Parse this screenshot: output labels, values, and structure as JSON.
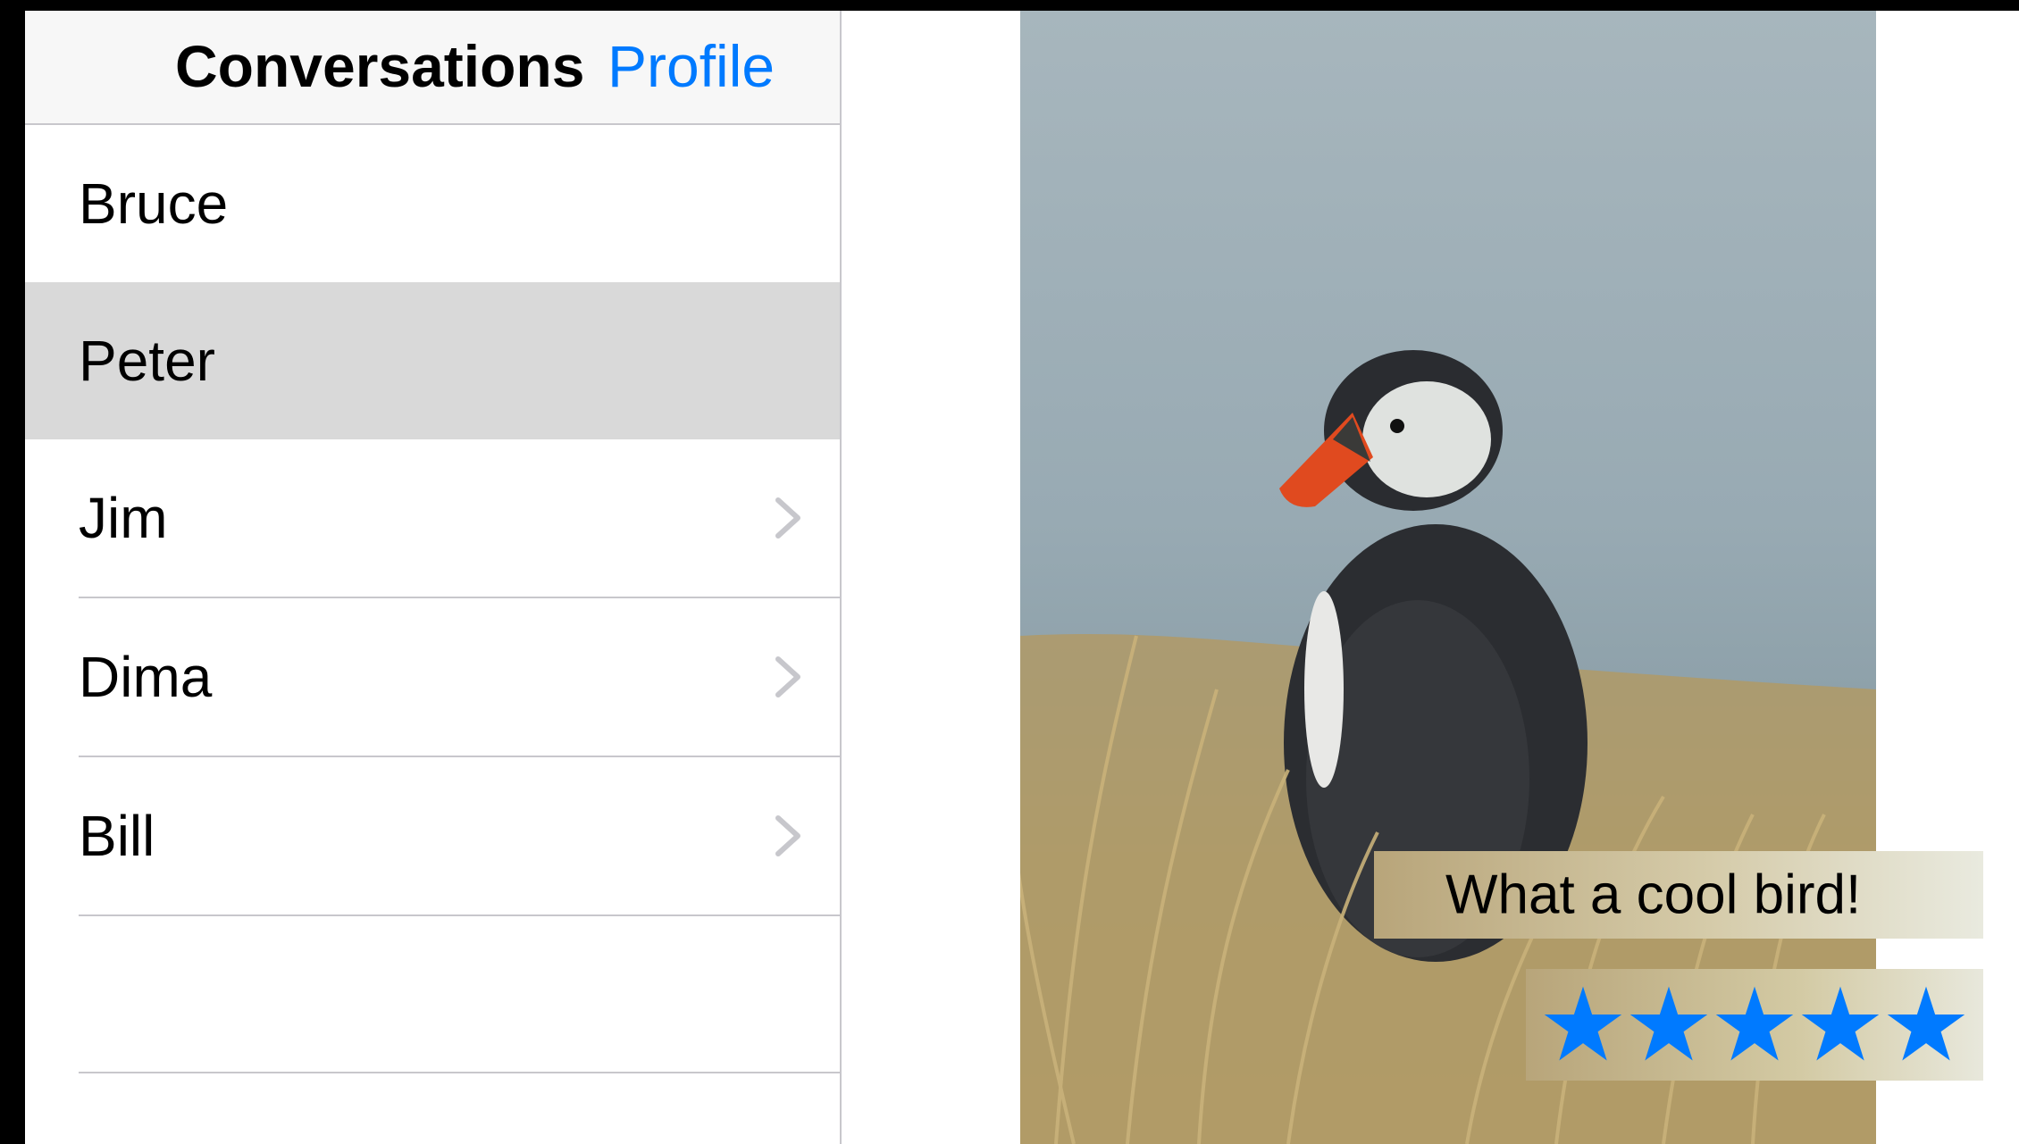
{
  "nav": {
    "title": "Conversations",
    "profile_label": "Profile"
  },
  "conversations": [
    {
      "name": "Bruce",
      "selected": false,
      "chevron": false
    },
    {
      "name": "Peter",
      "selected": true,
      "chevron": false
    },
    {
      "name": "Jim",
      "selected": false,
      "chevron": true
    },
    {
      "name": "Dima",
      "selected": false,
      "chevron": true
    },
    {
      "name": "Bill",
      "selected": false,
      "chevron": true
    }
  ],
  "detail": {
    "image_subject": "puffin-photo",
    "caption": "What a cool bird!",
    "rating": 5,
    "rating_max": 5
  },
  "colors": {
    "accent": "#007aff",
    "selected_row": "#d9d9d9",
    "separator": "#c8c7cc",
    "star": "#007aff"
  },
  "icons": {
    "chevron": "chevron-right-icon",
    "star": "star-icon"
  }
}
